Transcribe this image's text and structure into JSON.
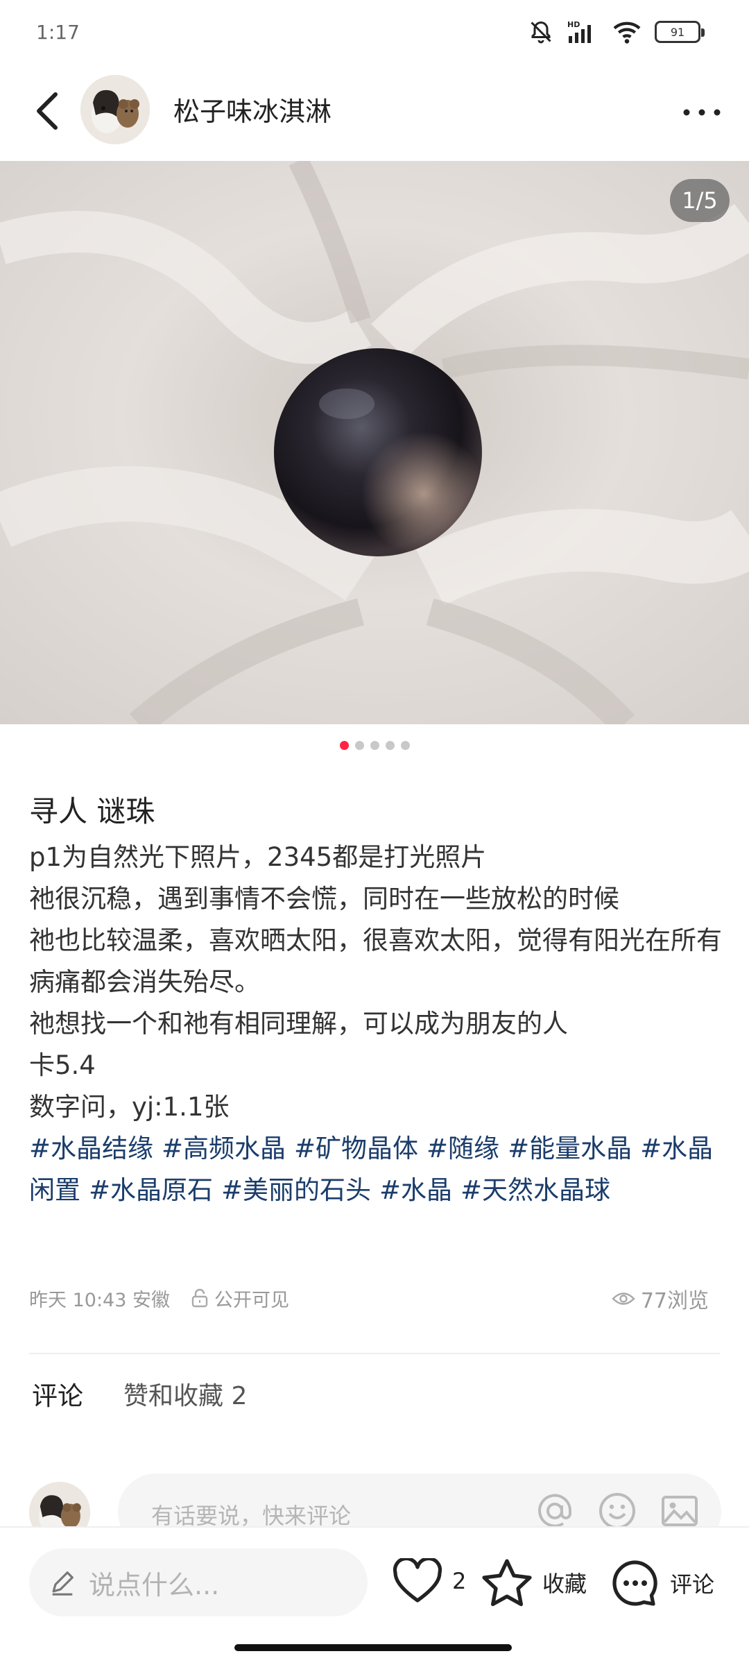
{
  "status": {
    "time": "1:17",
    "network": "HD",
    "battery": "91"
  },
  "header": {
    "username": "松子味冰淇淋",
    "back_icon": "chevron-left-icon",
    "more_icon": "more-horizontal-icon"
  },
  "post": {
    "image_counter": "1/5",
    "total_images": 5,
    "active_image": 1,
    "title": "寻人 谜珠",
    "description": [
      "p1为自然光下照片，2345都是打光照片",
      "祂很沉稳，遇到事情不会慌，同时在一些放松的时候",
      "祂也比较温柔，喜欢晒太阳，很喜欢太阳，觉得有阳光在所有病痛都会消失殆尽。",
      "祂想找一个和祂有相同理解，可以成为朋友的人",
      "卡5.4",
      "数字问，yj:1.1张"
    ],
    "tags": [
      "#水晶结缘",
      "#高频水晶",
      "#矿物晶体",
      "#随缘",
      "#能量水晶",
      "#水晶闲置",
      "#水晶原石",
      "#美丽的石头",
      "#水晶",
      "#天然水晶球"
    ],
    "meta_time": "昨天 10:43 安徽",
    "visibility": "公开可见",
    "views": "77浏览"
  },
  "comments": {
    "tab_comments": "评论",
    "tab_likes": "赞和收藏 2",
    "input_placeholder": "有话要说，快来评论"
  },
  "bottom_bar": {
    "say_placeholder": "说点什么...",
    "like_count": "2",
    "collect_label": "收藏",
    "comment_label": "评论"
  },
  "colors": {
    "accent": "#ff2442",
    "tag": "#1b3d6b"
  }
}
